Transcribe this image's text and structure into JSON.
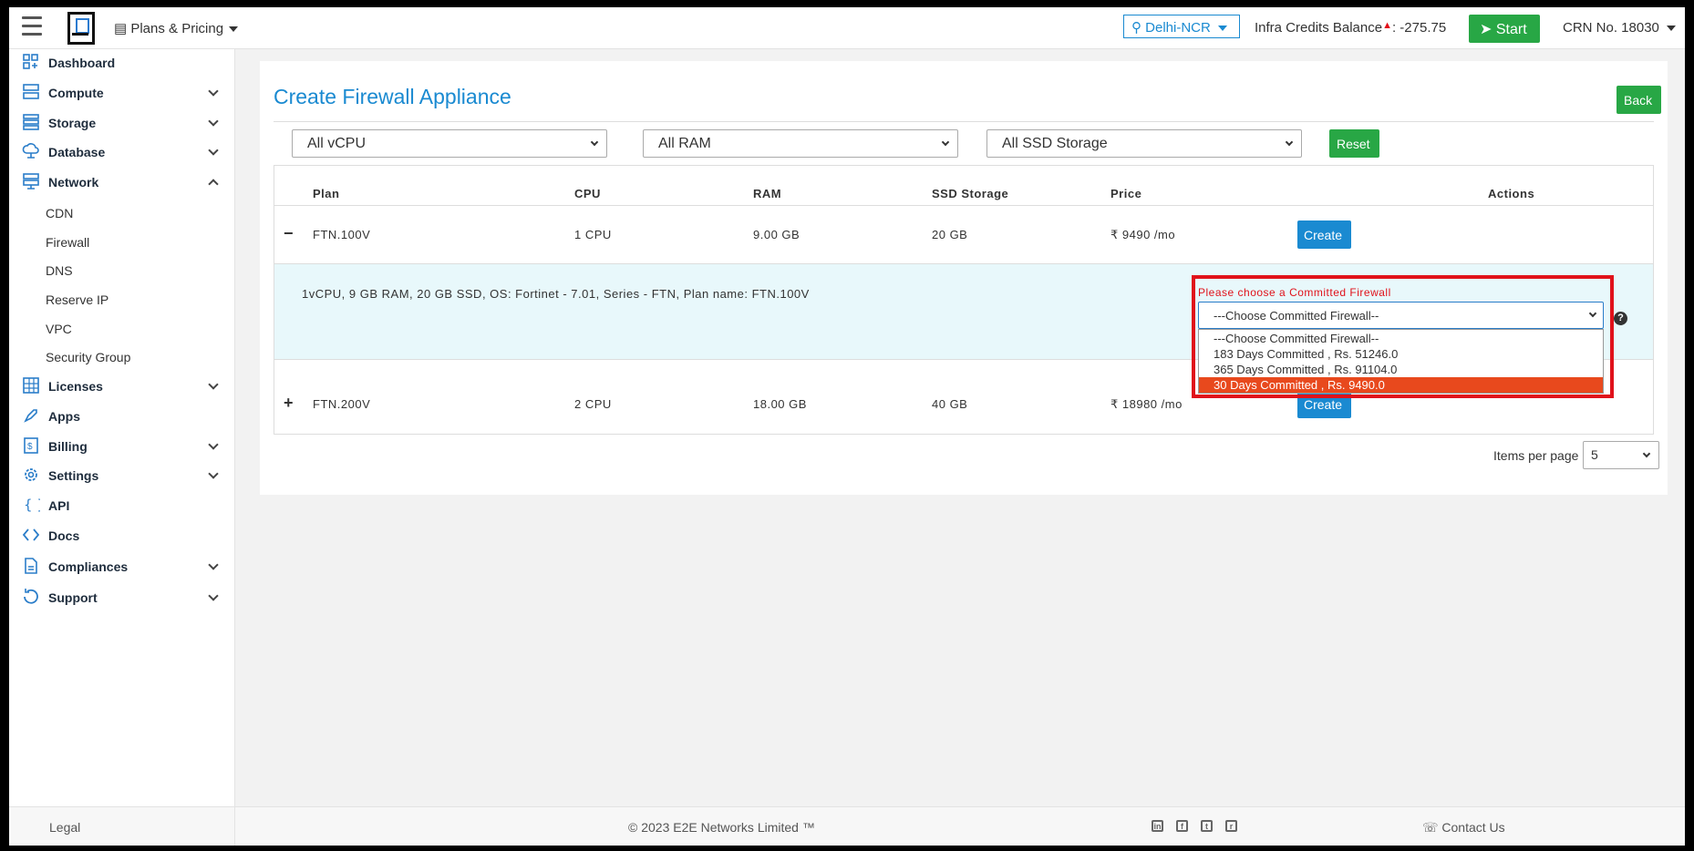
{
  "header": {
    "plans_label": "Plans & Pricing",
    "region": "Delhi-NCR",
    "credits_label": "Infra Credits Balance",
    "credits_value": ": -275.75",
    "start_label": "Start",
    "crn": "CRN No. 18030"
  },
  "sidebar": {
    "items": [
      {
        "label": "Dashboard",
        "icon": "dashboard-icon"
      },
      {
        "label": "Compute",
        "icon": "compute-icon"
      },
      {
        "label": "Storage",
        "icon": "storage-icon"
      },
      {
        "label": "Database",
        "icon": "database-icon"
      },
      {
        "label": "Network",
        "icon": "network-icon"
      },
      {
        "label": "Licenses",
        "icon": "licenses-icon"
      },
      {
        "label": "Apps",
        "icon": "apps-icon"
      },
      {
        "label": "Billing",
        "icon": "billing-icon"
      },
      {
        "label": "Settings",
        "icon": "settings-icon"
      },
      {
        "label": "API",
        "icon": "api-icon"
      },
      {
        "label": "Docs",
        "icon": "docs-icon"
      },
      {
        "label": "Compliances",
        "icon": "compliances-icon"
      },
      {
        "label": "Support",
        "icon": "support-icon"
      }
    ],
    "network_sub": [
      "CDN",
      "Firewall",
      "DNS",
      "Reserve IP",
      "VPC",
      "Security Group"
    ]
  },
  "main": {
    "title": "Create Firewall Appliance",
    "back_label": "Back",
    "filters": {
      "vcpu": "All vCPU",
      "ram": "All RAM",
      "ssd": "All SSD Storage",
      "reset_label": "Reset"
    },
    "table": {
      "headers": [
        "Plan",
        "CPU",
        "RAM",
        "SSD Storage",
        "Price",
        "Actions"
      ],
      "rows": [
        {
          "toggle": "−",
          "plan": "FTN.100V",
          "cpu": "1 CPU",
          "ram": "9.00 GB",
          "ssd": "20 GB",
          "price": "₹ 9490 /mo",
          "action": "Create"
        },
        {
          "toggle": "+",
          "plan": "FTN.200V",
          "cpu": "2 CPU",
          "ram": "18.00 GB",
          "ssd": "40 GB",
          "price": "₹ 18980 /mo",
          "action": "Create"
        }
      ],
      "detail": "1vCPU, 9 GB RAM, 20 GB SSD, OS: Fortinet - 7.01, Series - FTN, Plan name: FTN.100V"
    },
    "committed": {
      "label": "Please choose a Committed Firewall",
      "selected": "---Choose Committed Firewall--",
      "options": [
        "---Choose Committed Firewall--",
        "183 Days Committed , Rs. 51246.0",
        "365 Days Committed , Rs. 91104.0",
        "30 Days Committed , Rs. 9490.0"
      ],
      "highlighted_option": 3,
      "help": "?"
    },
    "pagination": {
      "items_label": "Items per page",
      "items_value": "5"
    }
  },
  "footer": {
    "legal": "Legal",
    "copyright": "© 2023 E2E Networks Limited ™",
    "social": [
      "in",
      "f",
      "t",
      "r"
    ],
    "contact": "Contact Us"
  },
  "colors": {
    "accent": "#1a8ad1",
    "success": "#28a745",
    "danger": "#e0121b",
    "highlight": "#e8491d"
  }
}
